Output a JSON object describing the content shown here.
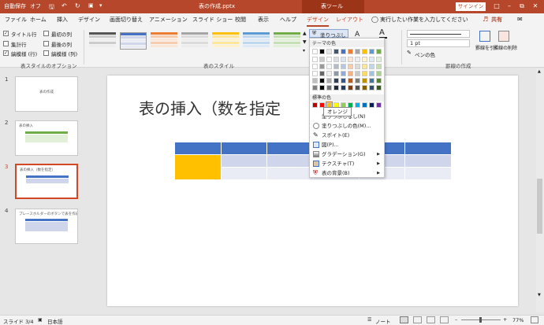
{
  "titlebar": {
    "autosave": "自動保存",
    "autosave_state": "オフ",
    "filename": "表の作成.pptx",
    "tool_tab": "表ツール",
    "signin": "サインイン"
  },
  "tabs": [
    "ファイル",
    "ホーム",
    "挿入",
    "デザイン",
    "画面切り替え",
    "アニメーション",
    "スライド ショー",
    "校閲",
    "表示",
    "ヘルプ",
    "デザイン",
    "レイアウト"
  ],
  "search_placeholder": "実行したい作業を入力してください",
  "share": "共有",
  "ribbon": {
    "options": {
      "header_row": "タイトル行",
      "total_row": "集計行",
      "banded_rows": "縞模様 (行)",
      "first_column": "最初の列",
      "last_column": "最後の列",
      "banded_columns": "縞模様 (列)",
      "group_label": "表スタイルのオプション"
    },
    "styles_group_label": "表のスタイル",
    "shading_button": "塗りつぶし",
    "pen_weight": "1 pt",
    "pen_color": "ペンの色",
    "draw_table": "罫線を引く",
    "eraser": "罫線の削除",
    "borders_group_label": "罫線の作成"
  },
  "dropdown": {
    "theme_colors": "テーマの色",
    "standard_colors": "標準の色",
    "items": [
      {
        "label": "塗りつぶしなし(N)"
      },
      {
        "label": "塗りつぶしの色(M)..."
      },
      {
        "label": "スポイト(E)"
      },
      {
        "label": "図(P)..."
      },
      {
        "label": "グラデーション(G)"
      },
      {
        "label": "テクスチャ(T)"
      },
      {
        "label": "表の背景(B)"
      }
    ],
    "tooltip": "オレンジ"
  },
  "slides": [
    {
      "num": "1",
      "title": "表の作成"
    },
    {
      "num": "2",
      "title": "表の挿入"
    },
    {
      "num": "3",
      "title": "表の挿入（数を指定）"
    },
    {
      "num": "4",
      "title": "プレースホルダーのボタンで表を作成"
    }
  ],
  "slide": {
    "title": "表の挿入（数を指定"
  },
  "status": {
    "slide_pos": "スライド 3/4",
    "language": "日本語",
    "notes": "ノート",
    "zoom": "77%"
  },
  "colors": {
    "accent": "#b7472a",
    "table_header": "#4472c4",
    "table_band": "#cfd5ea",
    "table_light": "#e9ebf5",
    "orange_cell": "#ffc000"
  },
  "theme_palette": [
    "#ffffff",
    "#000000",
    "#e7e6e6",
    "#44546a",
    "#4472c4",
    "#ed7d31",
    "#a5a5a5",
    "#ffc000",
    "#5b9bd5",
    "#70ad47"
  ],
  "standard_palette": [
    "#c00000",
    "#ff0000",
    "#ffc000",
    "#ffff00",
    "#92d050",
    "#00b050",
    "#00b0f0",
    "#0070c0",
    "#002060",
    "#7030a0"
  ]
}
